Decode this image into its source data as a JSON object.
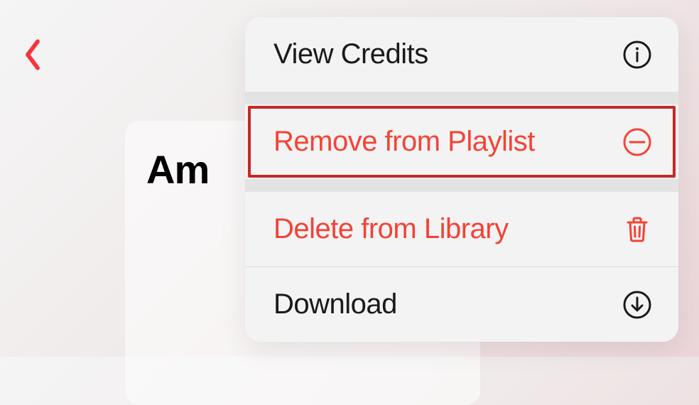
{
  "nav": {
    "back_aria": "Back"
  },
  "background": {
    "title_fragment": "Am"
  },
  "menu": {
    "items": [
      {
        "label": "View Credits",
        "color": "black",
        "icon": "info"
      },
      {
        "label": "Remove from Playlist",
        "color": "red",
        "icon": "remove-circle",
        "highlighted": true
      },
      {
        "label": "Delete from Library",
        "color": "red",
        "icon": "trash"
      },
      {
        "label": "Download",
        "color": "black",
        "icon": "download"
      }
    ]
  },
  "colors": {
    "accent_red": "#f44336",
    "highlight_border": "#c62828"
  }
}
